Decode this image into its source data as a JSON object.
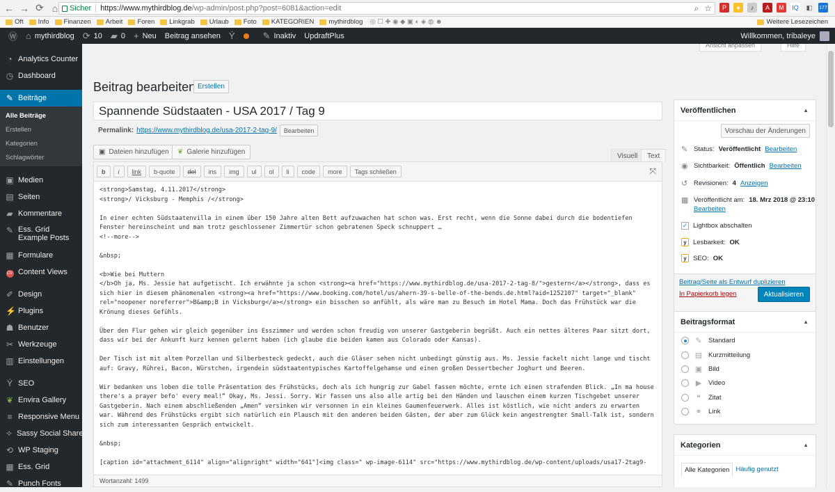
{
  "browser": {
    "secure_label": "Sicher",
    "url_host": "https://www.mythirdblog.de",
    "url_path": "/wp-admin/post.php?post=6081&action=edit",
    "bookmarks": [
      "Oft",
      "Info",
      "Finanzen",
      "Arbeit",
      "Foren",
      "Linkgrab",
      "Urlaub",
      "Foto",
      "KATEGORIEN",
      "mythirdblog"
    ],
    "other_bookmarks": "Weitere Lesezeichen",
    "ext_badge": "177"
  },
  "adminbar": {
    "site": "mythirdblog",
    "updates": "10",
    "comments": "0",
    "new": "Neu",
    "view_post": "Beitrag ansehen",
    "inactive": "Inaktiv",
    "updraft": "UpdraftPlus",
    "welcome": "Willkommen, tribaleye"
  },
  "sidebar": {
    "items_top": [
      {
        "label": "Analytics Counter",
        "icon": "chart-icon"
      },
      {
        "label": "Dashboard",
        "icon": "dashboard-icon"
      }
    ],
    "active": "Beiträge",
    "submenu": [
      "Alle Beiträge",
      "Erstellen",
      "Kategorien",
      "Schlagwörter"
    ],
    "items_mid": [
      "Medien",
      "Seiten",
      "Kommentare",
      "Ess. Grid Example Posts",
      "Formulare",
      "Content Views"
    ],
    "items_low": [
      "Design",
      "Plugins",
      "Benutzer",
      "Werkzeuge",
      "Einstellungen"
    ],
    "items_bottom": [
      "SEO",
      "Envira Gallery",
      "Responsive Menu",
      "Sassy Social Share",
      "WP Staging",
      "Ess. Grid",
      "Punch Fonts"
    ]
  },
  "screen_options": {
    "left": "Ansicht anpassen",
    "right": "Hilfe"
  },
  "page": {
    "title": "Beitrag bearbeiten",
    "add_new": "Erstellen",
    "post_title": "Spannende Südstaaten - USA 2017 / Tag 9",
    "permalink_label": "Permalink:",
    "permalink_url": "https://www.mythirdblog.de/usa-2017-2-tag-9/",
    "permalink_edit": "Bearbeiten",
    "add_media": "Dateien hinzufügen",
    "add_gallery": "Galerie hinzufügen",
    "tab_visual": "Visuell",
    "tab_text": "Text",
    "quicktags": [
      "b",
      "i",
      "link",
      "b-quote",
      "del",
      "ins",
      "img",
      "ul",
      "ol",
      "li",
      "code",
      "more",
      "Tags schließen"
    ],
    "word_count": "Wortanzahl: 1499",
    "content": "<strong>Samstag, 4.11.2017</strong>\n<strong>/ Vicksburg - Memphis /</strong>\n\nIn einer echten Südstaatenvilla in einem über 150 Jahre alten Bett aufzuwachen hat schon was. Erst recht, wenn die Sonne dabei durch die bodentiefen Fenster hereinscheint und man trotz geschlossener Zimmertür schon gebratenen Speck schnuppert …\n<!--more-->\n\n&nbsp;\n\n<b>Wie bei Muttern\n</b>Oh ja, Ms. Jessie hat aufgetischt. Ich erwähnte ja schon <strong><a href=\"https://www.mythirdblog.de/usa-2017-2-tag-8/\">gestern</a></strong>, dass es sich hier in diesem phänomenalen <strong><a href=\"https://www.booking.com/hotel/us/ahern-39-s-belle-of-the-bends.de.html?aid=1252107\" target=\"_blank\" rel=\"noopener noreferrer\">B&amp;B in Vicksburg</a></strong> ein bisschen so anfühlt, als wäre man zu Besuch im Hotel Mama. Doch das Frühstück war die Krönung dieses Gefühls.\n\nÜber den Flur gehen wir gleich gegenüber ins Esszimmer und werden schon freudig von unserer Gastgeberin begrüßt. Auch ein nettes älteres Paar sitzt dort, dass wir bei der Ankunft kurz kennen gelernt haben (ich glaube die beiden kamen aus Colorado oder Kansas).\n\nDer Tisch ist mit altem Porzellan und Silberbesteck gedeckt, auch die Gläser sehen nicht unbedingt günstig aus. Ms. Jessie fackelt nicht lange und tischt auf: Gravy, Rührei, Bacon, Würstchen, irgendein südstaatentypisches Kartoffelgehamse und einen großen Dessertbecher Joghurt und Beeren.\n\nWir bedanken uns loben die tolle Präsentation des Frühstücks, doch als ich hungrig zur Gabel fassen möchte, ernte ich einen strafenden Blick. „In ma house there's a prayer befo' every meal!“ Okay, Ms. Jessi. Sorry. Wir fassen uns also alle artig bei den Händen und lauschen einem kurzen Tischgebet unserer Gastgeberin. Nach einem abschließenden „Amen“ versinken wir versonnen in ein kleines Gaumenfeuerwerk. Alles ist köstlich, wie nicht anders zu erwarten war. Während des Frühstücks ergibt sich natürlich ein Plausch mit den anderen beiden Gästen, der aber zum Glück kein angestrengter Small-Talk ist, sondern sich zum interessanten Gespräch entwickelt.\n\n&nbsp;\n\n[caption id=\"attachment_6114\" align=\"alignright\" width=\"641\"]<img class=\" wp-image-6114\" src=\"https://www.mythirdblog.de/wp-content/uploads/usa17-2tag9-"
  },
  "publish": {
    "header": "Veröffentlichen",
    "preview": "Vorschau der Änderungen",
    "status_label": "Status:",
    "status_value": "Veröffentlicht",
    "visibility_label": "Sichtbarkeit:",
    "visibility_value": "Öffentlich",
    "revisions_label": "Revisionen:",
    "revisions_value": "4",
    "revisions_link": "Anzeigen",
    "published_label": "Veröffentlicht am:",
    "published_value": "18. Mrz 2018 @ 23:10",
    "edit": "Bearbeiten",
    "lightbox": "Lightbox abschalten",
    "readability_label": "Lesbarkeit:",
    "readability_value": "OK",
    "seo_label": "SEO:",
    "seo_value": "OK",
    "duplicate": "Beitrag/Seite als Entwurf duplizieren",
    "trash": "In Papierkorb legen",
    "update": "Aktualisieren"
  },
  "format": {
    "header": "Beitragsformat",
    "options": [
      "Standard",
      "Kurzmitteilung",
      "Bild",
      "Video",
      "Zitat",
      "Link"
    ],
    "selected": "Standard"
  },
  "categories": {
    "header": "Kategorien",
    "tab_all": "Alle Kategorien",
    "tab_popular": "Häufig genutzt"
  }
}
